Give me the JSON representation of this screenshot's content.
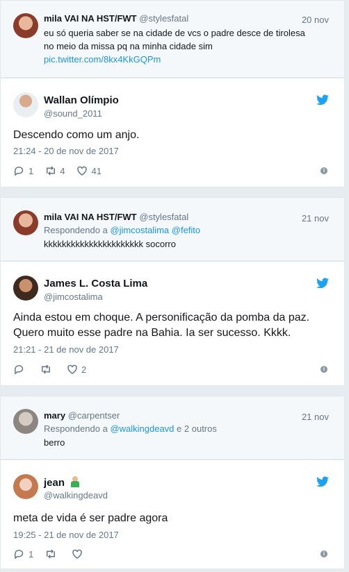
{
  "thread": [
    {
      "reply": {
        "name": "mila VAI NA HST/FWT",
        "handle": "@stylesfatal",
        "date": "20 nov",
        "text_line1": "eu só queria saber se na cidade de vcs o padre desce de tirolesa",
        "text_line2": "no meio da missa pq na minha cidade sim",
        "link": "pic.twitter.com/8kx4KkGQPm"
      },
      "main": {
        "name": "Wallan Olímpio",
        "handle": "@sound_2011",
        "text": "Descendo como um anjo.",
        "time": "21:24 - 20 de nov de 2017",
        "replies": "1",
        "retweets": "4",
        "likes": "41"
      }
    },
    {
      "reply": {
        "name": "mila VAI NA HST/FWT",
        "handle": "@stylesfatal",
        "date": "21 nov",
        "replying_prefix": "Respondendo a",
        "replying_to": "@jimcostalima @fefito",
        "text_line1": "kkkkkkkkkkkkkkkkkkkkkk socorro"
      },
      "main": {
        "name": "James L. Costa Lima",
        "handle": "@jimcostalima",
        "text_line1": "Ainda estou em choque. A personificação da pomba da paz.",
        "text_line2": "Quero muito esse padre na Bahia. Ia ser sucesso. Kkkk.",
        "time": "21:21 - 21 de nov de 2017",
        "replies": "",
        "retweets": "",
        "likes": "2"
      }
    },
    {
      "reply": {
        "name": "mary",
        "handle": "@carpentser",
        "date": "21 nov",
        "replying_prefix": "Respondendo a",
        "replying_to": "@walkingdeavd",
        "replying_suffix": "e 2 outros",
        "text_line1": "berro"
      },
      "main": {
        "name": "jean",
        "handle": "@walkingdeavd",
        "text": "meta de vida é ser padre agora",
        "time": "19:25 - 21 de nov de 2017",
        "replies": "1",
        "retweets": "",
        "likes": ""
      }
    }
  ],
  "colors": {
    "twitter_blue": "#1da1f2",
    "link": "#1b95e0",
    "muted": "#657786"
  }
}
